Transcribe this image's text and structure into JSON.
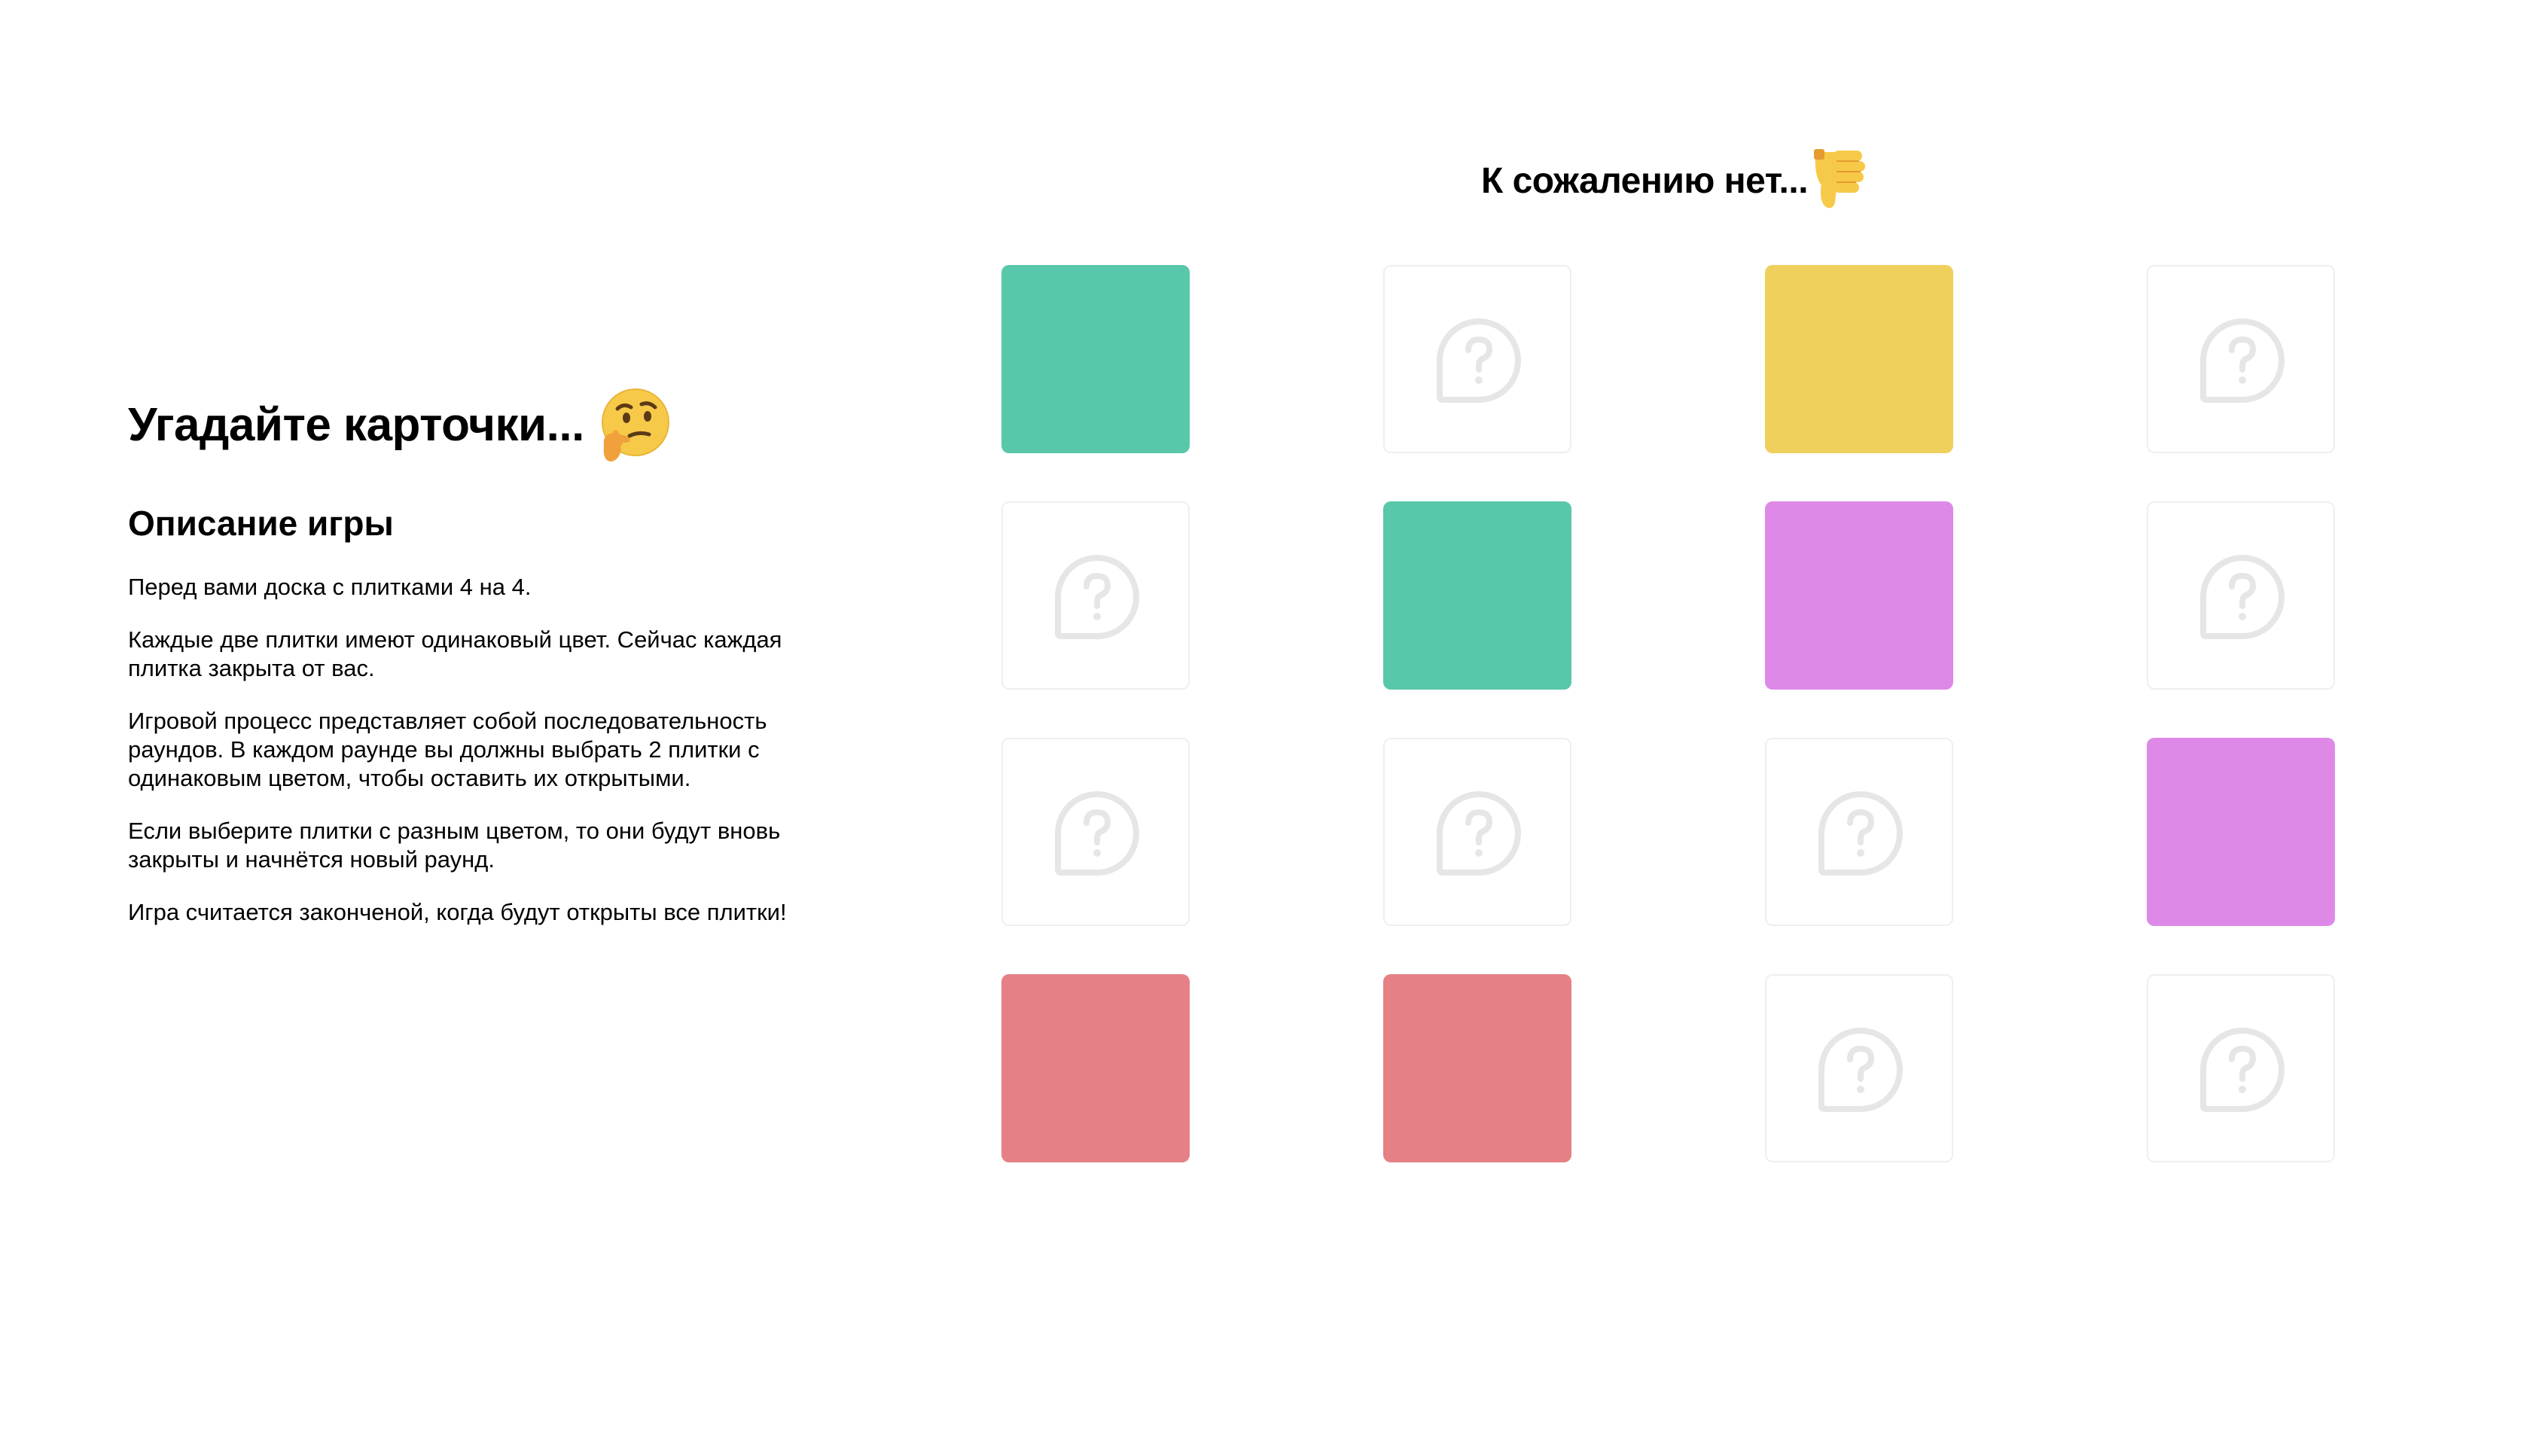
{
  "game": {
    "title": "Угадайте карточки...",
    "title_emoji": "thinking-face-icon",
    "description_heading": "Описание игры",
    "paragraphs": [
      "Перед вами доска с плитками 4 на 4.",
      "Каждые две плитки имеют одинаковый цвет. Сейчас каждая плитка закрыта от вас.",
      "Игровой процесс представляет собой последовательность раундов. В каждом раунде вы должны выбрать 2 плитки с одинаковым цветом, чтобы оставить их открытыми.",
      "Если выберите плитки с разным цветом, то они будут вновь закрыты и начнётся новый раунд.",
      "Игра считается законченой, когда будут открыты все плитки!"
    ]
  },
  "board": {
    "status": "К сожалению нет...",
    "status_emoji": "thumbs-down-icon",
    "rows": 4,
    "cols": 4,
    "closed_icon": "question-bubble-icon",
    "colors": {
      "green": "#59c7aa",
      "yellow": "#efd05c",
      "purple": "#de89e8",
      "red": "#e58186",
      "closed_border": "#efefef",
      "icon_gray": "#e6e6e6"
    },
    "tiles": [
      {
        "state": "open",
        "color": "green"
      },
      {
        "state": "closed"
      },
      {
        "state": "open",
        "color": "yellow"
      },
      {
        "state": "closed"
      },
      {
        "state": "closed"
      },
      {
        "state": "open",
        "color": "green"
      },
      {
        "state": "open",
        "color": "purple"
      },
      {
        "state": "closed"
      },
      {
        "state": "closed"
      },
      {
        "state": "closed"
      },
      {
        "state": "closed"
      },
      {
        "state": "open",
        "color": "purple"
      },
      {
        "state": "open",
        "color": "red"
      },
      {
        "state": "open",
        "color": "red"
      },
      {
        "state": "closed"
      },
      {
        "state": "closed"
      }
    ]
  }
}
